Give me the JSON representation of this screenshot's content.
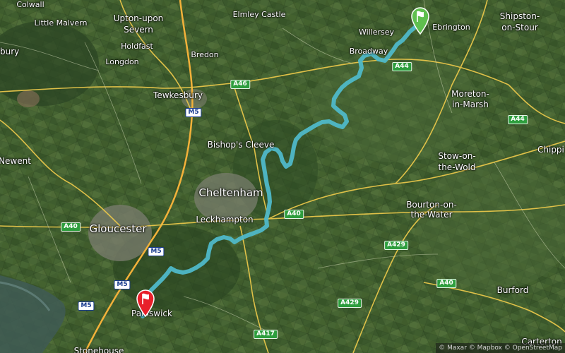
{
  "map": {
    "type": "satellite",
    "route_color": "#4fb8c8",
    "start_marker": {
      "color": "#5fbf4e",
      "icon": "flag-icon"
    },
    "end_marker": {
      "color": "#e8202a",
      "icon": "flag-icon"
    },
    "places": {
      "colwall": "Colwall",
      "little_malvern": "Little Malvern",
      "upton": "Upton-upon",
      "upton2": "Severn",
      "holdfast": "Holdfast",
      "longdon": "Longdon",
      "bredon": "Bredon",
      "elmley_castle": "Elmley Castle",
      "willersey": "Willersey",
      "ebrington": "Ebrington",
      "shipston": "Shipston-",
      "shipston2": "on-Stour",
      "broadway": "Broadway",
      "tewkesbury": "Tewkesbury",
      "moreton": "Moreton-",
      "moreton2": "in-Marsh",
      "bishops_cleeve": "Bishop's Cleeve",
      "newent": "Newent",
      "stow": "Stow-on-",
      "stow2": "the-Wold",
      "chipping": "Chippi",
      "cheltenham": "Cheltenham",
      "leckhampton": "Leckhampton",
      "gloucester": "Gloucester",
      "bourton": "Bourton-on-",
      "bourton2": "the-Water",
      "burford": "Burford",
      "painswick": "Painswick",
      "carterton": "Carterton",
      "ledbury": "bury",
      "stonehouse": "Stonehouse"
    },
    "roads": {
      "a46": "A46",
      "a44a": "A44",
      "a44b": "A44",
      "m5a": "M5",
      "m5b": "M5",
      "m5c": "M5",
      "m5d": "M5",
      "a40a": "A40",
      "a40b": "A40",
      "a40c": "A40",
      "a429a": "A429",
      "a429b": "A429",
      "a417": "A417"
    },
    "attribution": "© Maxar © Mapbox © OpenStreetMap"
  }
}
